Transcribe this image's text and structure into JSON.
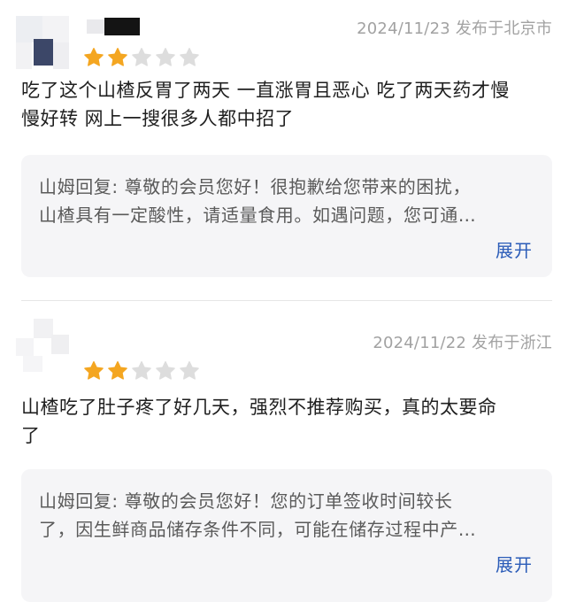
{
  "reviews": [
    {
      "date": "2024/11/23",
      "location": "发布于北京市",
      "rating": 2,
      "max_rating": 5,
      "content": "吃了这个山楂反胃了两天 一直涨胃且恶心 吃了两天药才慢慢好转 网上一搜很多人都中招了",
      "content_lines": [
        "吃了这个山楂反胃了两天 一直涨胃且恶心 吃了两天药才慢",
        "慢好转 网上一搜很多人都中招了"
      ],
      "reply_lines": [
        "山姆回复: 尊敬的会员您好！很抱歉给您带来的困扰，",
        "山楂具有一定酸性，请适量食用。如遇问题，您可通…"
      ],
      "expand_label": "展开"
    },
    {
      "date": "2024/11/22",
      "location": "发布于浙江",
      "rating": 2,
      "max_rating": 5,
      "content": "山楂吃了肚子疼了好几天，强烈不推荐购买，真的太要命了",
      "content_lines": [
        "山楂吃了肚子疼了好几天，强烈不推荐购买，真的太要命",
        "了"
      ],
      "reply_lines": [
        "山姆回复: 尊敬的会员您好！您的订单签收时间较长",
        "了，因生鲜商品储存条件不同，可能在储存过程中产…"
      ],
      "expand_label": "展开"
    }
  ],
  "colors": {
    "star_filled": "#f4a621",
    "star_empty": "#dddddd",
    "link": "#2b5cb8",
    "meta": "#a2a2a2",
    "reply_bg": "#f5f5f7"
  },
  "icons": {
    "star_filled": "star-filled-icon",
    "star_empty": "star-empty-icon"
  }
}
